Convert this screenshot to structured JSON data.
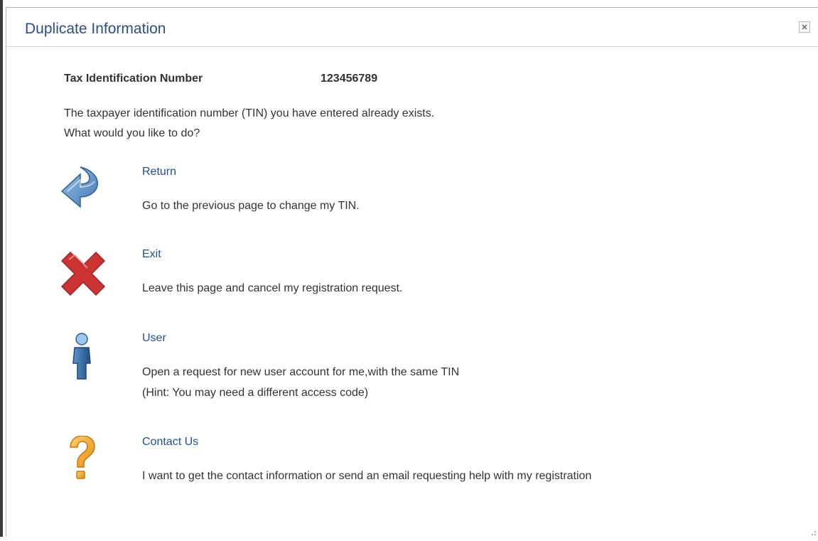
{
  "dialog": {
    "title": "Duplicate Information",
    "close_icon": "close-icon",
    "tin_label": "Tax Identification Number",
    "tin_value": "123456789",
    "message_line1": "The taxpayer identification number (TIN) you have entered already exists.",
    "message_line2": "What would you like to do?"
  },
  "options": [
    {
      "icon": "return-arrow-icon",
      "label": "Return",
      "desc_line1": "Go to the previous page to change my TIN.",
      "desc_line2": ""
    },
    {
      "icon": "red-x-icon",
      "label": "Exit",
      "desc_line1": "Leave this page and cancel my registration request.",
      "desc_line2": ""
    },
    {
      "icon": "user-icon",
      "label": "User",
      "desc_line1": "Open a request for new user account for me,with the same TIN",
      "desc_line2": "(Hint: You may need a different access code)"
    },
    {
      "icon": "question-mark-icon",
      "label": "Contact Us",
      "desc_line1": "I want to get the contact information or send an email requesting help with my registration",
      "desc_line2": ""
    }
  ],
  "colors": {
    "title": "#2a4f86",
    "link": "#1f4f99",
    "body_text": "#333333",
    "return_icon": "#5a8fc4",
    "exit_icon": "#cc3333",
    "user_icon": "#3f78b2",
    "help_icon": "#f0a020"
  }
}
